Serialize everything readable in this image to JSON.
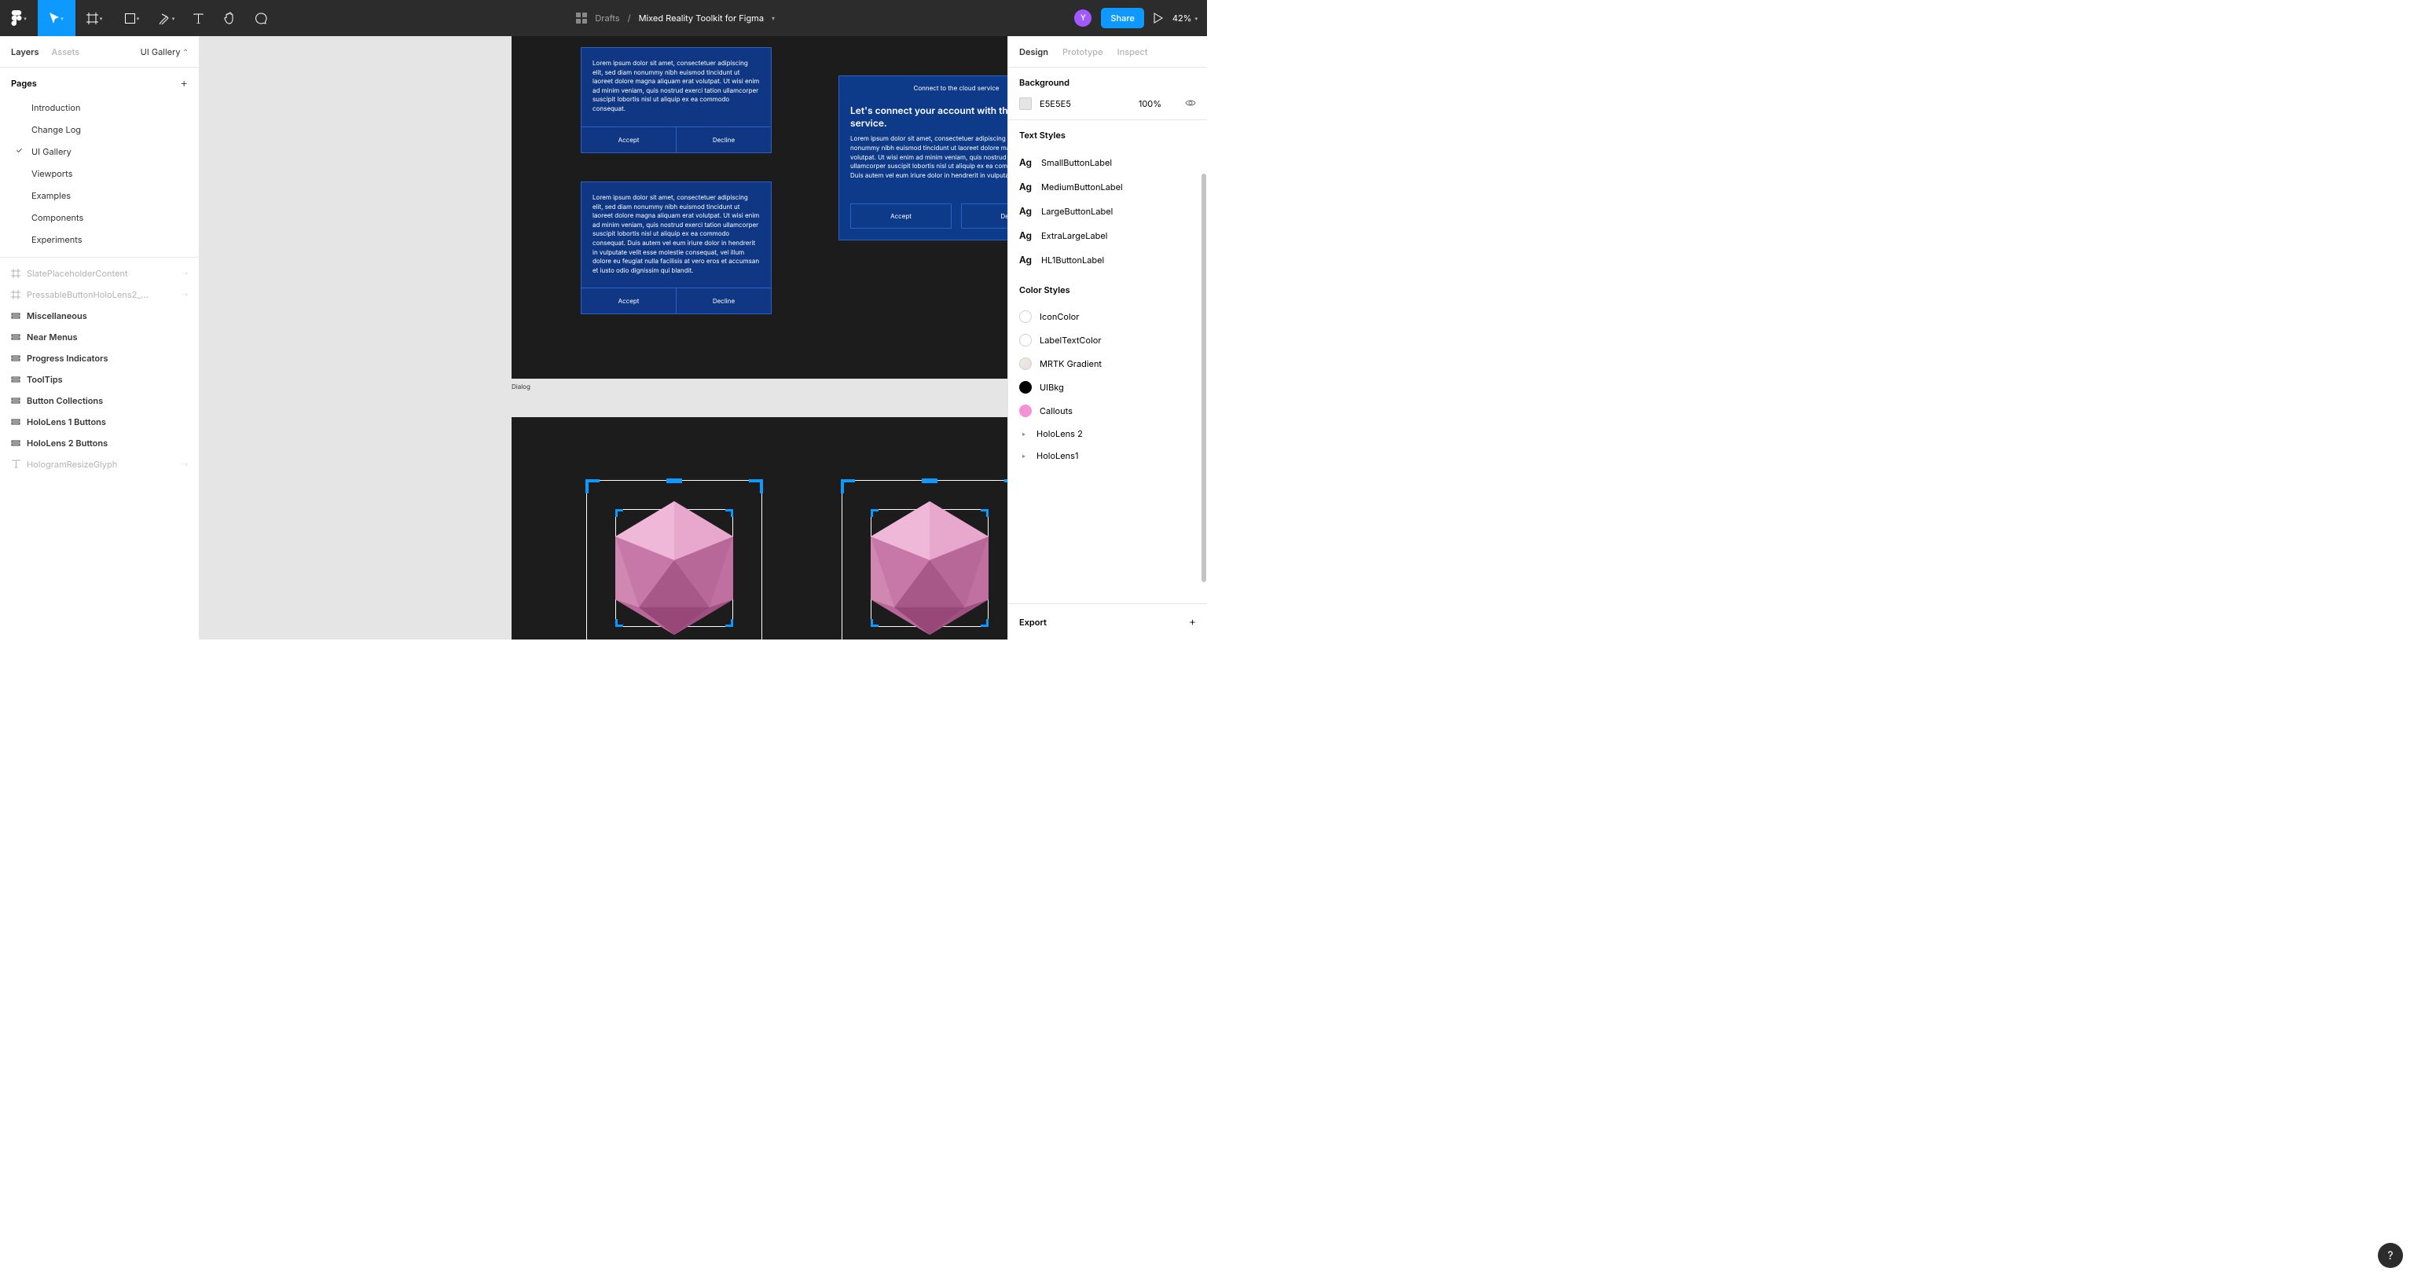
{
  "toolbar": {
    "folder": "Drafts",
    "filename": "Mixed Reality Toolkit for Figma",
    "avatar_initial": "Y",
    "share_label": "Share",
    "zoom": "42%"
  },
  "left_panel": {
    "tabs": {
      "layers": "Layers",
      "assets": "Assets"
    },
    "page_selector": "UI Gallery",
    "pages_head": "Pages",
    "pages": [
      "Introduction",
      "Change Log",
      "UI Gallery",
      "Viewports",
      "Examples",
      "Components",
      "Experiments"
    ],
    "selected_page_index": 2,
    "layers": [
      {
        "name": "SlatePlaceholderContent",
        "icon": "frame",
        "dim": true,
        "tail": true
      },
      {
        "name": "PressableButtonHoloLens2_...",
        "icon": "frame",
        "dim": true,
        "tail": true
      },
      {
        "name": "Miscellaneous",
        "icon": "autolayout",
        "bold": true
      },
      {
        "name": "Near Menus",
        "icon": "autolayout",
        "bold": true
      },
      {
        "name": "Progress Indicators",
        "icon": "autolayout",
        "bold": true
      },
      {
        "name": "ToolTips",
        "icon": "autolayout",
        "bold": true
      },
      {
        "name": "Button Collections",
        "icon": "autolayout",
        "bold": true
      },
      {
        "name": "HoloLens 1 Buttons",
        "icon": "autolayout",
        "bold": true
      },
      {
        "name": "HoloLens 2 Buttons",
        "icon": "autolayout",
        "bold": true
      },
      {
        "name": "HologramResizeGlyph",
        "icon": "text",
        "dim": true,
        "tail": true
      }
    ]
  },
  "canvas": {
    "frame1_label": "Dialog",
    "dialog1_text": "Lorem ipsum dolor sit amet, consectetuer adipiscing elit, sed diam nonummy nibh euismod tincidunt ut laoreet dolore magna aliquam erat volutpat. Ut wisi enim ad minim veniam, quis nostrud exerci tation ullamcorper suscipit lobortis nisl ut aliquip ex ea commodo consequat.",
    "dialog2_text": "Lorem ipsum dolor sit amet, consectetuer adipiscing elit, sed diam nonummy nibh euismod tincidunt ut laoreet dolore magna aliquam erat volutpat. Ut wisi enim ad minim veniam, quis nostrud exerci tation ullamcorper suscipit lobortis nisl ut aliquip ex ea commodo consequat. Duis autem vel eum iriure dolor in hendrerit in vulputate velit esse molestie consequat, vel illum dolore eu feugiat nulla facilisis at vero eros et accumsan et iusto odio dignissim qui blandit.",
    "dialog3_header": "Connect to the cloud service",
    "dialog3_title": "Let's connect your account with the cloud service.",
    "dialog3_text": "Lorem ipsum dolor sit amet, consectetuer adipiscing elit, sed diam nonummy nibh euismod tincidunt ut laoreet dolore magna aliquam erat volutpat. Ut wisi enim ad minim veniam, quis nostrud exerci tation ullamcorper suscipit lobortis nisl ut aliquip ex ea commodo consequat. Duis autem vel eum iriure dolor in hendrerit in vulputate velit.",
    "accept_label": "Accept",
    "decline_label": "Decline"
  },
  "right_panel": {
    "tabs": {
      "design": "Design",
      "prototype": "Prototype",
      "inspect": "Inspect"
    },
    "background_head": "Background",
    "bg_hex": "E5E5E5",
    "bg_pct": "100%",
    "text_styles_head": "Text Styles",
    "text_styles": [
      "SmallButtonLabel",
      "MediumButtonLabel",
      "LargeButtonLabel",
      "ExtraLargeLabel",
      "HL1ButtonLabel"
    ],
    "color_styles_head": "Color Styles",
    "color_styles": [
      {
        "name": "IconColor",
        "color": "#ffffff",
        "border": "#d0d0d0"
      },
      {
        "name": "LabelTextColor",
        "color": "#ffffff",
        "border": "#d0d0d0"
      },
      {
        "name": "MRTK Gradient",
        "color": "linear-gradient(135deg,#e8f0d8,#f0d8e8)",
        "border": "#d0d0d0"
      },
      {
        "name": "UIBkg",
        "color": "#000000",
        "border": "#000000"
      },
      {
        "name": "Callouts",
        "color": "#f48fd8",
        "border": "#f48fd8"
      }
    ],
    "color_groups": [
      "HoloLens 2",
      "HoloLens1"
    ],
    "export_head": "Export"
  },
  "ag": "Ag"
}
